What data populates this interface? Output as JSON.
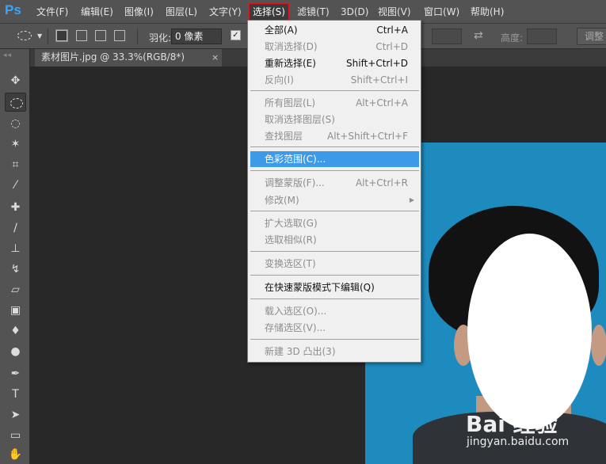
{
  "app": {
    "logo": "Ps",
    "accent_color": "#31a8ff"
  },
  "menubar": {
    "items": [
      {
        "label": "文件(F)"
      },
      {
        "label": "编辑(E)"
      },
      {
        "label": "图像(I)"
      },
      {
        "label": "图层(L)"
      },
      {
        "label": "文字(Y)"
      },
      {
        "label": "选择(S)",
        "active": true,
        "highlight_color": "#e0161d"
      },
      {
        "label": "滤镜(T)"
      },
      {
        "label": "3D(D)"
      },
      {
        "label": "视图(V)"
      },
      {
        "label": "窗口(W)"
      },
      {
        "label": "帮助(H)"
      }
    ]
  },
  "options": {
    "feather_label": "羽化:",
    "feather_value": "0 像素",
    "height_label": "高度:",
    "refine_button": "调整"
  },
  "document": {
    "tab_title": "素材图片.jpg @ 33.3%(RGB/8*)",
    "tab_close": "×",
    "background_color": "#1d8bbd"
  },
  "select_menu": {
    "items": [
      {
        "label": "全部(A)",
        "shortcut": "Ctrl+A",
        "enabled": true
      },
      {
        "label": "取消选择(D)",
        "shortcut": "Ctrl+D",
        "enabled": false
      },
      {
        "label": "重新选择(E)",
        "shortcut": "Shift+Ctrl+D",
        "enabled": true
      },
      {
        "label": "反向(I)",
        "shortcut": "Shift+Ctrl+I",
        "enabled": false
      },
      {
        "label": "所有图层(L)",
        "shortcut": "Alt+Ctrl+A",
        "enabled": false
      },
      {
        "label": "取消选择图层(S)",
        "shortcut": "",
        "enabled": false
      },
      {
        "label": "查找图层",
        "shortcut": "Alt+Shift+Ctrl+F",
        "enabled": false
      },
      {
        "label": "色彩范围(C)...",
        "shortcut": "",
        "enabled": true,
        "highlighted": true
      },
      {
        "label": "调整蒙版(F)...",
        "shortcut": "Alt+Ctrl+R",
        "enabled": false
      },
      {
        "label": "修改(M)",
        "shortcut": "",
        "enabled": false,
        "submenu": true
      },
      {
        "label": "扩大选取(G)",
        "shortcut": "",
        "enabled": false
      },
      {
        "label": "选取相似(R)",
        "shortcut": "",
        "enabled": false
      },
      {
        "label": "变换选区(T)",
        "shortcut": "",
        "enabled": false
      },
      {
        "label": "在快速蒙版模式下编辑(Q)",
        "shortcut": "",
        "enabled": true
      },
      {
        "label": "载入选区(O)...",
        "shortcut": "",
        "enabled": false
      },
      {
        "label": "存储选区(V)...",
        "shortcut": "",
        "enabled": false
      },
      {
        "label": "新建 3D 凸出(3)",
        "shortcut": "",
        "enabled": false
      }
    ],
    "highlight_color": "#3d9ae8"
  },
  "tools": [
    {
      "icon": "move-tool-icon"
    },
    {
      "icon": "elliptical-marquee-tool-icon",
      "active": true
    },
    {
      "icon": "lasso-tool-icon"
    },
    {
      "icon": "magic-wand-tool-icon"
    },
    {
      "icon": "crop-tool-icon"
    },
    {
      "icon": "eyedropper-tool-icon"
    },
    {
      "icon": "healing-brush-tool-icon"
    },
    {
      "icon": "brush-tool-icon"
    },
    {
      "icon": "clone-stamp-tool-icon"
    },
    {
      "icon": "history-brush-tool-icon"
    },
    {
      "icon": "eraser-tool-icon"
    },
    {
      "icon": "gradient-tool-icon"
    },
    {
      "icon": "blur-tool-icon"
    },
    {
      "icon": "dodge-tool-icon"
    },
    {
      "icon": "pen-tool-icon"
    },
    {
      "icon": "type-tool-icon",
      "glyph": "T"
    },
    {
      "icon": "path-selection-tool-icon"
    },
    {
      "icon": "rectangle-tool-icon"
    },
    {
      "icon": "hand-tool-icon"
    }
  ],
  "watermark": {
    "main": "Bai 经验",
    "sub": "jingyan.baidu.com"
  }
}
